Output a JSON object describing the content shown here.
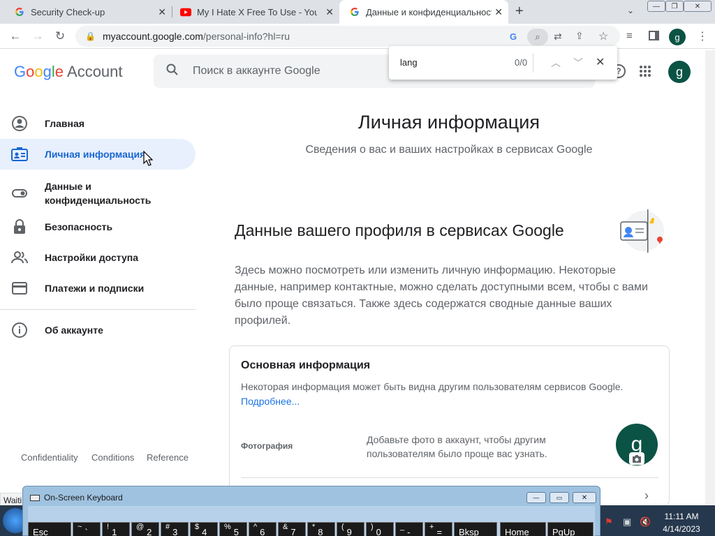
{
  "browser": {
    "tabs": [
      {
        "title": "Security Check-up",
        "favicon": "google-g-icon",
        "active": false
      },
      {
        "title": "My I Hate X Free To Use - YouTube",
        "favicon": "youtube-icon",
        "active": false
      },
      {
        "title": "Данные и конфиденциальность",
        "favicon": "google-g-icon",
        "active": true
      }
    ],
    "new_tab": "+",
    "address": {
      "host": "myaccount.google.com",
      "path": "/personal-info?hl=ru"
    },
    "profile_initial": "g"
  },
  "find_bar": {
    "query": "lang",
    "count": "0/0"
  },
  "header": {
    "logo": {
      "g1": "G",
      "o1": "o",
      "o2": "o",
      "g2": "g",
      "l": "l",
      "e": "e",
      "account": "Account"
    },
    "search_placeholder": "Поиск в аккаунте Google",
    "avatar_initial": "g"
  },
  "sidebar": {
    "items": [
      {
        "label": "Главная",
        "icon": "account-circle-icon"
      },
      {
        "label": "Личная информация",
        "icon": "id-card-icon",
        "active": true
      },
      {
        "label": "Данные и конфиденциальность",
        "icon": "toggle-icon"
      },
      {
        "label": "Безопасность",
        "icon": "lock-icon"
      },
      {
        "label": "Настройки доступа",
        "icon": "people-icon"
      },
      {
        "label": "Платежи и подписки",
        "icon": "credit-card-icon"
      }
    ],
    "about": {
      "label": "Об аккаунте",
      "icon": "info-icon"
    },
    "footer": [
      "Confidentiality",
      "Conditions",
      "Reference"
    ]
  },
  "main": {
    "title": "Личная информация",
    "subtitle": "Сведения о вас и ваших настройках в сервисах Google",
    "section_title": "Данные вашего профиля в сервисах Google",
    "section_text": "Здесь можно посмотреть или изменить личную информацию. Некоторые данные, например контактные, можно сделать доступными всем, чтобы с вами было проще связаться. Также здесь содержатся сводные данные ваших профилей.",
    "card": {
      "title": "Основная информация",
      "desc": "Некоторая информация может быть видна другим пользователям сервисов Google.",
      "link": "Подробнее...",
      "photo_label": "Фотография",
      "photo_desc": "Добавьте фото в аккаунт, чтобы другим пользователям было проще вас узнать.",
      "avatar_initial": "g"
    }
  },
  "status_text": "Waiti",
  "osk": {
    "title": "On-Screen Keyboard",
    "keys": [
      {
        "top": "",
        "bottom": "Esc"
      },
      {
        "top": "~",
        "bottom": "`"
      },
      {
        "top": "!",
        "bottom": "1"
      },
      {
        "top": "@",
        "bottom": "2"
      },
      {
        "top": "#",
        "bottom": "3"
      },
      {
        "top": "$",
        "bottom": "4"
      },
      {
        "top": "%",
        "bottom": "5"
      },
      {
        "top": "^",
        "bottom": "6"
      },
      {
        "top": "&",
        "bottom": "7"
      },
      {
        "top": "*",
        "bottom": "8"
      },
      {
        "top": "(",
        "bottom": "9"
      },
      {
        "top": ")",
        "bottom": "0"
      },
      {
        "top": "_",
        "bottom": "-"
      },
      {
        "top": "+",
        "bottom": "="
      },
      {
        "top": "",
        "bottom": "Bksp"
      },
      {
        "top": "",
        "bottom": "Home"
      },
      {
        "top": "",
        "bottom": "PgUp"
      }
    ]
  },
  "taskbar": {
    "time": "11:11 AM",
    "date": "4/14/2023"
  },
  "colors": {
    "accent": "#1a73e8",
    "active_nav_bg": "#e8f0fe",
    "avatar": "#0b5345"
  }
}
